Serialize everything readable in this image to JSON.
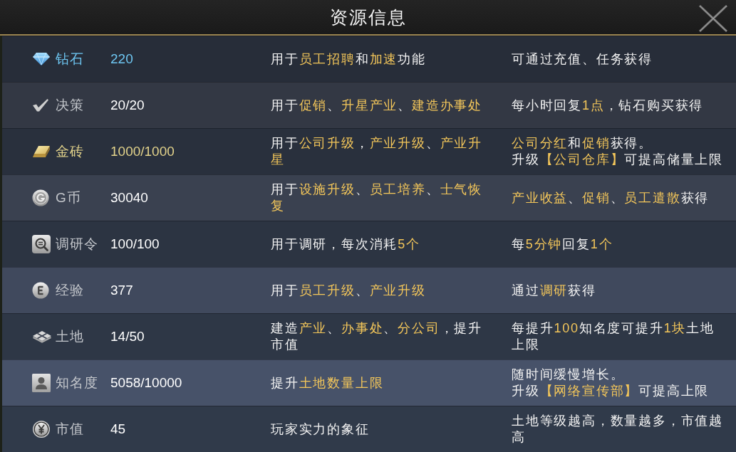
{
  "window": {
    "title": "资源信息"
  },
  "resources": [
    {
      "name": "钻石",
      "amount": "220",
      "color": "#6ec6f2",
      "usage": "用于**员工招聘**和**加速**功能",
      "source": [
        "可通过充值、任务获得"
      ]
    },
    {
      "name": "决策",
      "amount": "20/20",
      "usage": "用于**促销**、**升星产业**、**建造办事处**",
      "source": [
        "每小时回复**1点**，钻石购买获得"
      ]
    },
    {
      "name": "金砖",
      "amount": "1000/1000",
      "color": "#e3d38b",
      "usage": "用于**公司升级**，**产业升级**、**产业升星**",
      "source": [
        "**公司分红**和**促销**获得。",
        "升级**【公司仓库】**可提高储量上限"
      ]
    },
    {
      "name": "G币",
      "amount": "30040",
      "usage": "用于**设施升级**、**员工培养**、**士气恢复**",
      "source": [
        "**产业收益**、**促销**、**员工遣散**获得"
      ]
    },
    {
      "name": "调研令",
      "amount": "100/100",
      "usage": "用于调研，每次消耗**5个**",
      "source": [
        "每**5分钟**回复**1个**"
      ]
    },
    {
      "name": "经验",
      "amount": "377",
      "usage": "用于**员工升级**、**产业升级**",
      "source": [
        "通过**调研**获得"
      ]
    },
    {
      "name": "土地",
      "amount": "14/50",
      "usage": "建造**产业**、**办事处**、**分公司**，提升市值",
      "source": [
        "每提升**100**知名度可提升**1块**土地上限"
      ]
    },
    {
      "name": "知名度",
      "amount": "5058/10000",
      "usage": "提升**土地数量上限**",
      "source": [
        "随时间缓慢增长。",
        "升级**【网络宣传部】**可提高上限"
      ]
    },
    {
      "name": "市值",
      "amount": "45",
      "usage": "玩家实力的象征",
      "source": [
        "土地等级越高，数量越多，市值越高"
      ]
    }
  ]
}
